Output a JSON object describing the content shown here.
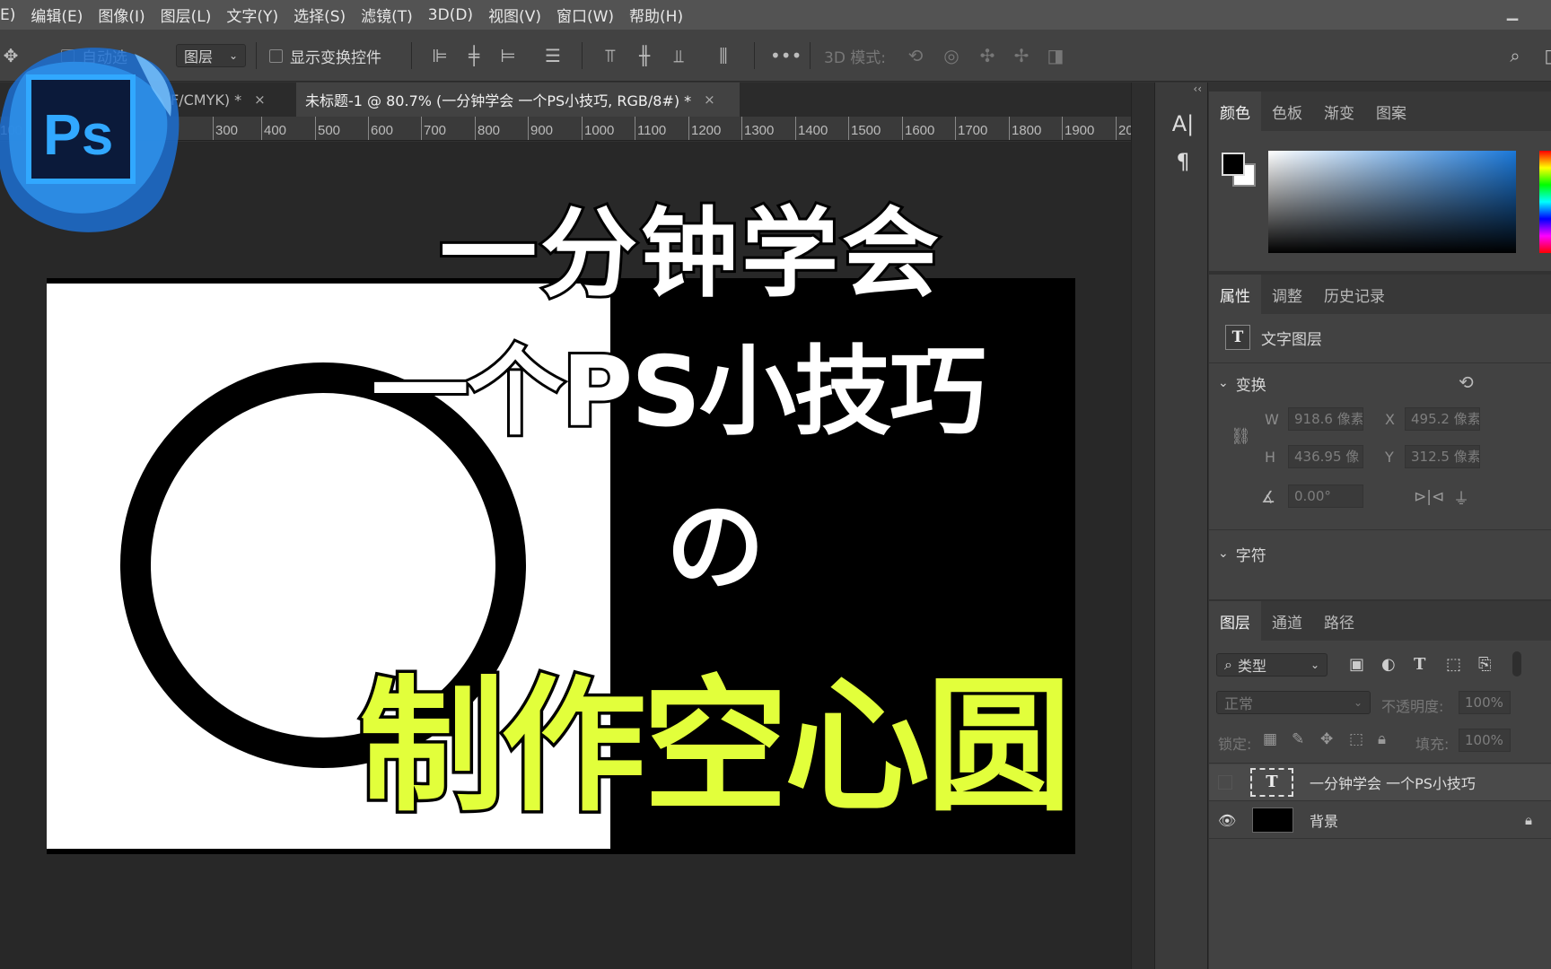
{
  "menu": [
    "E)",
    "编辑(E)",
    "图像(I)",
    "图层(L)",
    "文字(Y)",
    "选择(S)",
    "滤镜(T)",
    "3D(D)",
    "视图(V)",
    "窗口(W)",
    "帮助(H)"
  ],
  "options": {
    "auto_select_label": "自动选",
    "layer_dropdown": "图层",
    "show_transform_label": "显示变换控件",
    "three_d_mode_label": "3D 模式:"
  },
  "tabs": [
    {
      "label": "F/CMYK) *",
      "close": "×"
    },
    {
      "label": "未标题-1 @ 80.7% (一分钟学会 一个PS小技巧, RGB/8#) *",
      "close": "×"
    }
  ],
  "ruler": [
    "100",
    "300",
    "400",
    "500",
    "600",
    "700",
    "800",
    "900",
    "1000",
    "1100",
    "1200",
    "1300",
    "1400",
    "1500",
    "1600",
    "1700",
    "1800",
    "1900",
    "20"
  ],
  "logo": {
    "text": "Ps"
  },
  "overlay": {
    "line1": "一分钟学会",
    "line2": "一个PS小技巧",
    "line3": "の",
    "line4": "制作空心圆"
  },
  "color_panel": {
    "tabs": [
      "颜色",
      "色板",
      "渐变",
      "图案"
    ]
  },
  "props_panel": {
    "tabs": [
      "属性",
      "调整",
      "历史记录"
    ],
    "layer_type": "文字图层",
    "transform_title": "变换",
    "w_label": "W",
    "w_value": "918.6 像素",
    "x_label": "X",
    "x_value": "495.2 像素",
    "h_label": "H",
    "h_value": "436.95 像",
    "y_label": "Y",
    "y_value": "312.5 像素",
    "angle_value": "0.00°",
    "character_title": "字符"
  },
  "layers_panel": {
    "tabs": [
      "图层",
      "通道",
      "路径"
    ],
    "filter_label": "类型",
    "blend_mode": "正常",
    "opacity_label": "不透明度:",
    "opacity_value": "100%",
    "lock_label": "锁定:",
    "fill_label": "填充:",
    "fill_value": "100%",
    "layers": [
      {
        "name": "一分钟学会 一个PS小技巧",
        "type": "text",
        "visible": false
      },
      {
        "name": "背景",
        "type": "background",
        "visible": true,
        "locked": true
      }
    ]
  },
  "mini_strip": {
    "collapse": "‹‹"
  },
  "colors": {
    "accent_yellow": "#e2ff3b",
    "ps_blue": "#31a8ff"
  }
}
